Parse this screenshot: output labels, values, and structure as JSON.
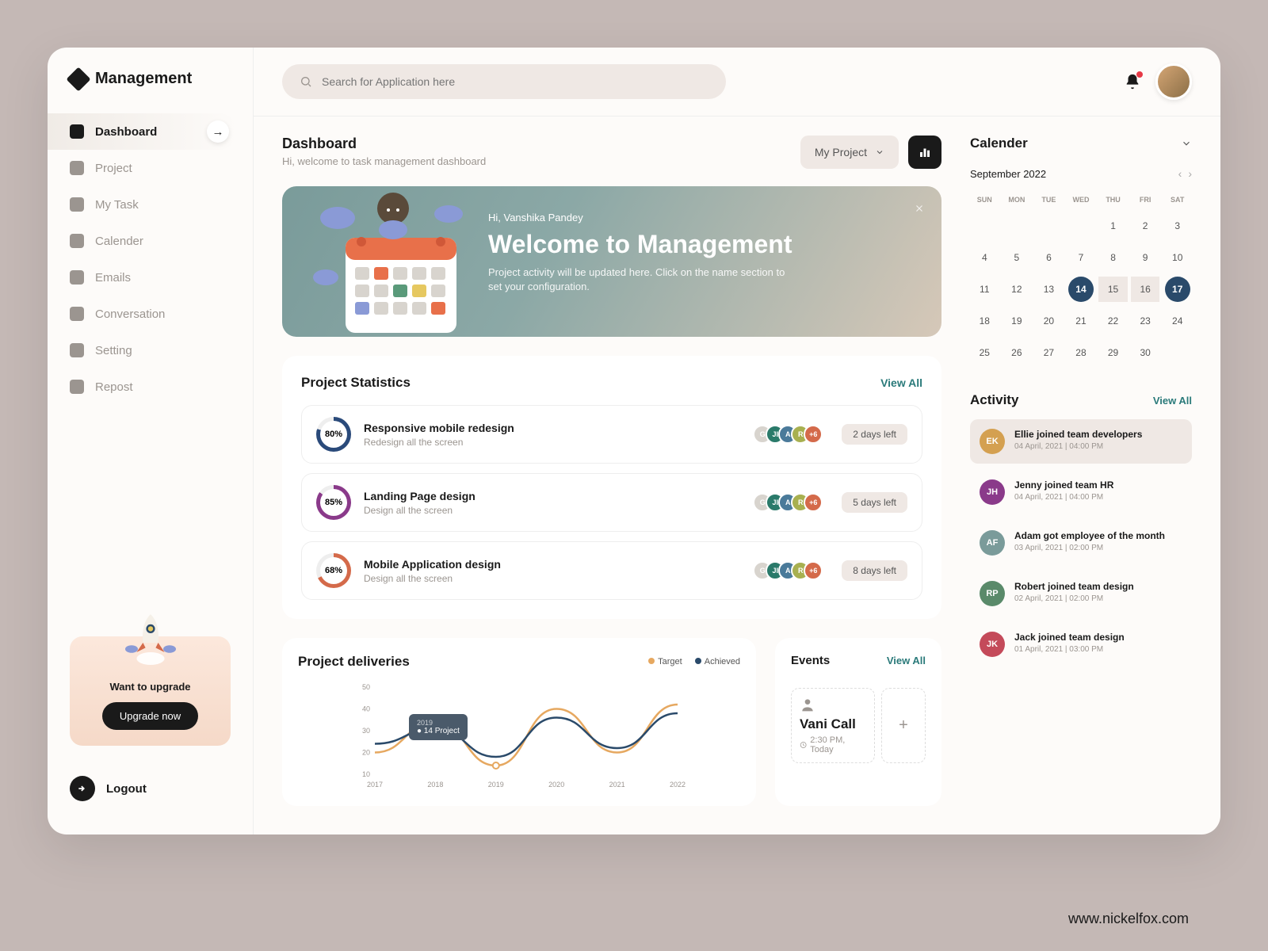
{
  "brand": "Management",
  "search": {
    "placeholder": "Search for Application here"
  },
  "sidebar": {
    "items": [
      {
        "label": "Dashboard",
        "active": true
      },
      {
        "label": "Project"
      },
      {
        "label": "My Task"
      },
      {
        "label": "Calender"
      },
      {
        "label": "Emails"
      },
      {
        "label": "Conversation"
      },
      {
        "label": "Setting"
      },
      {
        "label": "Repost"
      }
    ],
    "upgrade": {
      "text": "Want to upgrade",
      "cta": "Upgrade now"
    },
    "logout": "Logout"
  },
  "header": {
    "title": "Dashboard",
    "subtitle": "Hi, welcome to task management dashboard",
    "my_project": "My Project"
  },
  "banner": {
    "greet": "Hi, Vanshika Pandey",
    "title": "Welcome to Management",
    "desc": "Project activity will be updated here. Click on the name section to set your configuration."
  },
  "stats": {
    "title": "Project Statistics",
    "view_all": "View All",
    "rows": [
      {
        "pct": "80%",
        "color": "#2a4a7a",
        "title": "Responsive mobile redesign",
        "sub": "Redesign all the screen",
        "due": "2 days left"
      },
      {
        "pct": "85%",
        "color": "#8a3a8a",
        "title": "Landing Page design",
        "sub": "Design all the screen",
        "due": "5 days left"
      },
      {
        "pct": "68%",
        "color": "#d46a4a",
        "title": "Mobile Application design",
        "sub": "Design all the screen",
        "due": "8 days left"
      }
    ],
    "avatars": [
      {
        "bg": "#d8d4ce",
        "tx": "G"
      },
      {
        "bg": "#2a7a6a",
        "tx": "JI"
      },
      {
        "bg": "#4a7a9a",
        "tx": "A"
      },
      {
        "bg": "#a8b050",
        "tx": "R"
      },
      {
        "bg": "#d46a4a",
        "tx": "+6"
      }
    ]
  },
  "deliveries": {
    "title": "Project deliveries",
    "legend": {
      "target": "Target",
      "achieved": "Achieved"
    },
    "tooltip": {
      "year": "2019",
      "value": "● 14 Project"
    }
  },
  "events": {
    "title": "Events",
    "view_all": "View All",
    "item": {
      "name": "Vani Call",
      "time": "2:30 PM, Today"
    }
  },
  "calendar": {
    "title": "Calender",
    "month": "September 2022",
    "dow": [
      "SUN",
      "MON",
      "TUE",
      "WED",
      "THU",
      "FRI",
      "SAT"
    ],
    "start_blank": 4,
    "days": 30,
    "selected": [
      14,
      17
    ],
    "range": [
      15,
      16
    ]
  },
  "activity": {
    "title": "Activity",
    "view_all": "View All",
    "items": [
      {
        "av": "EK",
        "bg": "#d4a050",
        "text": "Ellie joined team developers",
        "time": "04 April, 2021 | 04:00 PM",
        "hl": true
      },
      {
        "av": "JH",
        "bg": "#8a3a8a",
        "text": "Jenny joined team HR",
        "time": "04 April, 2021 | 04:00 PM"
      },
      {
        "av": "AF",
        "bg": "#7a9b9a",
        "text": "Adam got employee of the month",
        "time": "03 April, 2021 | 02:00 PM"
      },
      {
        "av": "RP",
        "bg": "#5a8a6a",
        "text": "Robert joined team design",
        "time": "02 April, 2021 | 02:00 PM"
      },
      {
        "av": "JK",
        "bg": "#c44a5a",
        "text": "Jack joined team design",
        "time": "01 April, 2021 | 03:00 PM"
      }
    ]
  },
  "chart_data": {
    "type": "line",
    "title": "Project deliveries",
    "xlabel": "",
    "ylabel": "",
    "x": [
      "2017",
      "2018",
      "2019",
      "2020",
      "2021",
      "2022"
    ],
    "series": [
      {
        "name": "Target",
        "values": [
          20,
          34,
          14,
          40,
          20,
          42
        ]
      },
      {
        "name": "Achieved",
        "values": [
          24,
          31,
          18,
          36,
          22,
          38
        ]
      }
    ],
    "ylim": [
      10,
      50
    ],
    "y_ticks": [
      10,
      20,
      30,
      40,
      50
    ],
    "colors": {
      "Target": "#e6a860",
      "Achieved": "#2a4a6a"
    },
    "annotation": {
      "x": "2019",
      "series": "Target",
      "label": "14 Project"
    }
  },
  "watermark": "www.nickelfox.com"
}
